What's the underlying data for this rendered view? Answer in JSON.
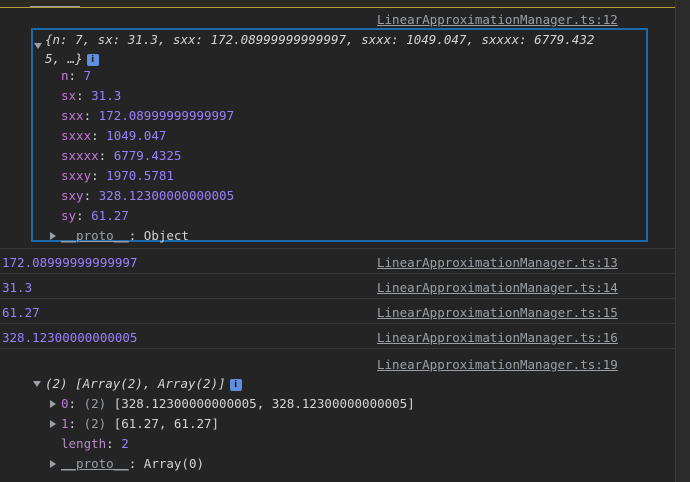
{
  "log1": {
    "source": "LinearApproximationManager.ts:12",
    "summary_line1": "{n: 7, sx: 31.3, sxx: 172.08999999999997, sxxx: 1049.047, sxxxx: 6779.432",
    "summary_line2": "5, …}",
    "info_badge": "i",
    "props": [
      {
        "key": "n",
        "value": "7"
      },
      {
        "key": "sx",
        "value": "31.3"
      },
      {
        "key": "sxx",
        "value": "172.08999999999997"
      },
      {
        "key": "sxxx",
        "value": "1049.047"
      },
      {
        "key": "sxxxx",
        "value": "6779.4325"
      },
      {
        "key": "sxxy",
        "value": "1970.5781"
      },
      {
        "key": "sxy",
        "value": "328.12300000000005"
      },
      {
        "key": "sy",
        "value": "61.27"
      }
    ],
    "proto_key": "__proto__",
    "proto_value": "Object"
  },
  "log2": {
    "value": "172.08999999999997",
    "source": "LinearApproximationManager.ts:13"
  },
  "log3": {
    "value": "31.3",
    "source": "LinearApproximationManager.ts:14"
  },
  "log4": {
    "value": "61.27",
    "source": "LinearApproximationManager.ts:15"
  },
  "log5": {
    "value": "328.12300000000005",
    "source": "LinearApproximationManager.ts:16"
  },
  "log6": {
    "source": "LinearApproximationManager.ts:19",
    "summary": "(2) [Array(2), Array(2)]",
    "info_badge": "i",
    "items": [
      {
        "key": "0",
        "count": "(2)",
        "value": "[328.12300000000005, 328.12300000000005]"
      },
      {
        "key": "1",
        "count": "(2)",
        "value": "[61.27, 61.27]"
      }
    ],
    "length_key": "length",
    "length_value": "2",
    "proto_key": "__proto__",
    "proto_value": "Array(0)"
  }
}
